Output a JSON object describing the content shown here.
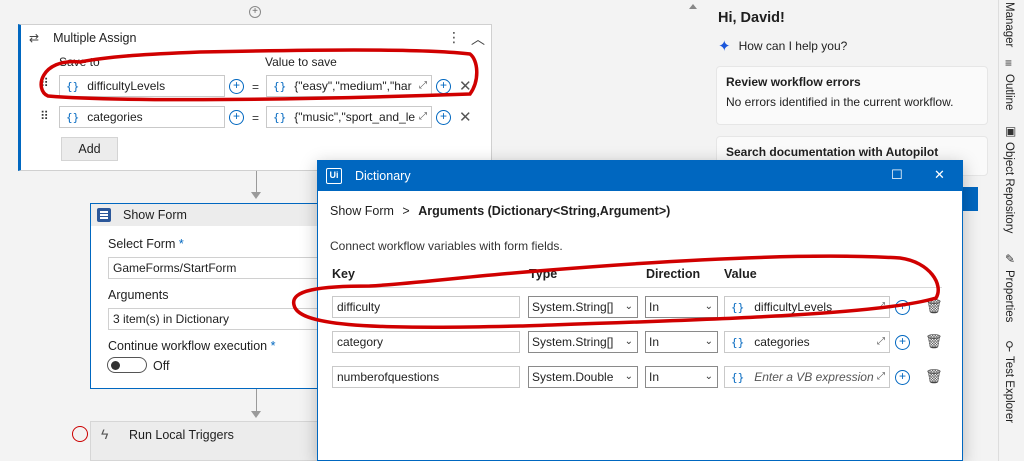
{
  "multiple_assign": {
    "title": "Multiple Assign",
    "save_to_label": "Save to",
    "value_label": "Value to save",
    "rows": [
      {
        "target": "difficultyLevels",
        "value": "{\"easy\",\"medium\",\"har"
      },
      {
        "target": "categories",
        "value": "{\"music\",\"sport_and_le"
      }
    ],
    "add_label": "Add",
    "brace": "{}",
    "equals": "="
  },
  "show_form": {
    "title": "Show Form",
    "select_form_label": "Select Form",
    "select_form_value": "GameForms/StartForm",
    "arguments_label": "Arguments",
    "arguments_value": "3 item(s) in Dictionary",
    "continue_label": "Continue workflow execution",
    "toggle_text": "Off",
    "required_mark": "*"
  },
  "run_local_triggers": {
    "title": "Run Local Triggers"
  },
  "assistant": {
    "greeting": "Hi, David!",
    "help_prompt": "How can I help you?",
    "cards": [
      {
        "title": "Review workflow errors",
        "text": "No errors identified in the current workflow."
      },
      {
        "title": "Search documentation with Autopilot",
        "text": ""
      }
    ]
  },
  "side_tabs": [
    "Manager",
    "Outline",
    "Object Repository",
    "Properties",
    "Test Explorer"
  ],
  "dialog": {
    "badge": "Ui",
    "title": "Dictionary",
    "crumb_root": "Show Form",
    "crumb_sep": ">",
    "crumb_current": "Arguments (Dictionary<String,Argument>)",
    "description": "Connect workflow variables with form fields.",
    "columns": {
      "key": "Key",
      "type": "Type",
      "direction": "Direction",
      "value": "Value"
    },
    "rows": [
      {
        "key": "difficulty",
        "type": "System.String[]",
        "direction": "In",
        "value": "difficultyLevels",
        "placeholder": false
      },
      {
        "key": "category",
        "type": "System.String[]",
        "direction": "In",
        "value": "categories",
        "placeholder": false
      },
      {
        "key": "numberofquestions",
        "type": "System.Double",
        "direction": "In",
        "value": "Enter a VB expression",
        "placeholder": true
      }
    ]
  },
  "colors": {
    "accent": "#0067c0",
    "annotation": "#d00000"
  }
}
